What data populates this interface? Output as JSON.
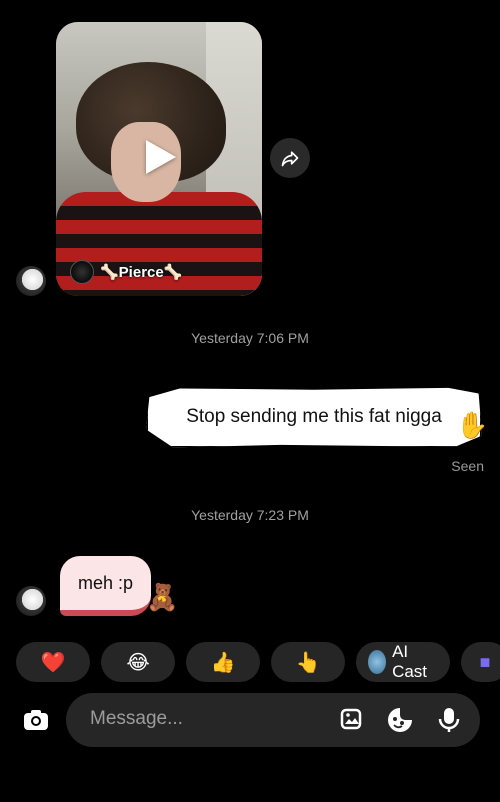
{
  "video": {
    "owner_name": "🦴Pierce🦴"
  },
  "messages": {
    "timestamp_1": "Yesterday 7:06 PM",
    "sent_text": "Stop sending me this fat nigga",
    "sent_status": "Seen",
    "timestamp_2": "Yesterday 7:23 PM",
    "received_text": "meh :p"
  },
  "quick_reactions": [
    "❤️",
    "😂",
    "👍",
    "👆"
  ],
  "ai_cast_label": "AI Cast",
  "composer": {
    "placeholder": "Message..."
  },
  "icons": {
    "share": "share-icon",
    "play": "play-icon",
    "camera": "camera-icon",
    "gallery": "gallery-icon",
    "sticker": "sticker-icon",
    "microphone": "microphone-icon"
  }
}
